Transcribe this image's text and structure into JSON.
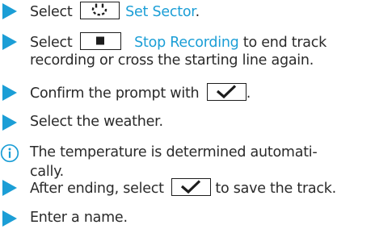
{
  "instructions": [
    {
      "type": "step",
      "icon": "play-triangle-icon",
      "before": "Select",
      "button_icon": "sector-flag-icon",
      "link": "Set Sector",
      "after": "."
    },
    {
      "type": "step",
      "icon": "play-triangle-icon",
      "before": "Select",
      "button_icon": "stop-square-icon",
      "link": "Stop Recording",
      "after": " to end track",
      "line2": "recording or cross the starting line again."
    },
    {
      "type": "step",
      "icon": "play-triangle-icon",
      "before": "Confirm the prompt with",
      "button_icon": "checkmark-icon",
      "after": "."
    },
    {
      "type": "step",
      "icon": "play-triangle-icon",
      "text": "Select the weather."
    },
    {
      "type": "note",
      "icon": "info-circle-icon",
      "line1": "The temperature is determined automati-",
      "line2": "cally."
    },
    {
      "type": "step",
      "icon": "play-triangle-icon",
      "before": "After ending, select",
      "button_icon": "checkmark-icon",
      "after": " to save the track."
    },
    {
      "type": "step",
      "icon": "play-triangle-icon",
      "text": "Enter a name."
    }
  ],
  "colors": {
    "marker": "#1b9ed6",
    "link": "#1b9ed6",
    "text": "#2a2a2a",
    "button_border": "#1d1d1d"
  }
}
